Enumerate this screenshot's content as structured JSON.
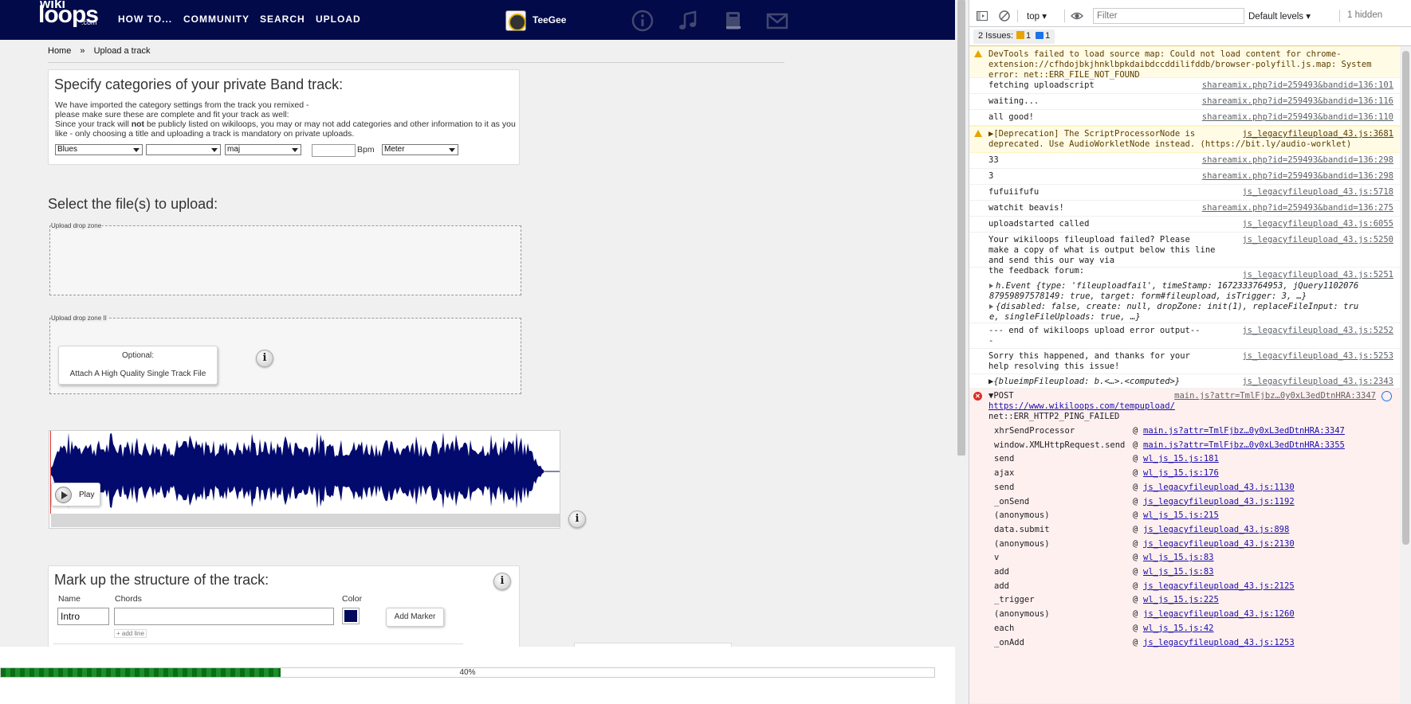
{
  "site": {
    "logo": {
      "line1": "wiki",
      "line2": "loops",
      "line3": ".com"
    },
    "nav": [
      "HOW TO...",
      "COMMUNITY",
      "SEARCH",
      "UPLOAD"
    ],
    "user": "TeeGee",
    "nav_icons": [
      "info-icon",
      "music-note-icon",
      "book-icon",
      "mail-icon"
    ],
    "breadcrumb": {
      "home": "Home",
      "sep": "»",
      "current": "Upload a track"
    },
    "categories": {
      "title": "Specify categories of your private Band track:",
      "text1": "We have imported the category settings from the track you remixed -",
      "text2": "please make sure these are complete and fit your track as well:",
      "text3_pre": "Since your track will ",
      "text3_bold": "not",
      "text3_post": " be publicly listed on wikiloops, you may or may not add categories and other information to it as you like - only choosing a title and uploading a track is mandatory on private uploads.",
      "genre": "Blues",
      "second": "",
      "key_mode": "maj",
      "bpm": "",
      "bpm_label": "Bpm",
      "meter": "Meter"
    },
    "select_heading": "Select the file(s) to upload:",
    "dropzone1_label": "Upload drop zone",
    "dropzone2_label": "Upload drop zone II",
    "attach": {
      "line1": "Optional:",
      "line2": "Attach A High Quality Single Track File"
    },
    "info_glyph": "i",
    "play_label": "Play",
    "markup": {
      "title": "Mark up the structure of the track:",
      "name_label": "Name",
      "chords_label": "Chords",
      "color_label": "Color",
      "name_value": "Intro",
      "chords_value": "",
      "add_marker": "Add Marker",
      "add_line": "+ add line",
      "marker_color": "#020a5e"
    },
    "progress": {
      "percent": 40,
      "label": "40%"
    },
    "colors": {
      "nav_bg": "#020a4a",
      "wave": "#020a6e",
      "progress": "#1c8f2a"
    }
  },
  "devtools": {
    "context": "top",
    "filter_placeholder": "Filter",
    "levels": "Default levels ▾",
    "hidden": "1 hidden",
    "issues": {
      "label": "2 Issues:",
      "warn": "1",
      "info": "1"
    },
    "rows": [
      {
        "type": "warn",
        "msg": "DevTools failed to load source map: Could not load content for chrome-extension://cfhdojbkjhnklbpkdaibdccddilifddb/browser-polyfill.js.map: System error: net::ERR_FILE_NOT_FOUND",
        "src": ""
      },
      {
        "type": "log",
        "msg": "fetching uploadscript",
        "src": "shareamix.php?id=259493&bandid=136:101"
      },
      {
        "type": "log",
        "msg": "waiting...",
        "src": "shareamix.php?id=259493&bandid=136:116"
      },
      {
        "type": "log",
        "msg": "all good!",
        "src": "shareamix.php?id=259493&bandid=136:110"
      },
      {
        "type": "warn",
        "msg": "▶[Deprecation] The ScriptProcessorNode is\ndeprecated. Use AudioWorkletNode instead. (https://bit.ly/audio-worklet)",
        "src": "js_legacyfileupload_43.js:3681"
      },
      {
        "type": "log",
        "msg": "33",
        "src": "shareamix.php?id=259493&bandid=136:298"
      },
      {
        "type": "log",
        "msg": "3",
        "src": "shareamix.php?id=259493&bandid=136:298"
      },
      {
        "type": "log",
        "msg": "fufuiifufu",
        "src": "js_legacyfileupload_43.js:5718"
      },
      {
        "type": "log",
        "msg": "watchit beavis!",
        "src": "shareamix.php?id=259493&bandid=136:275"
      },
      {
        "type": "log",
        "msg": "uploadstarted called",
        "src": "js_legacyfileupload_43.js:6055"
      },
      {
        "type": "log",
        "msg": "Your wikiloops fileupload failed? Please\nmake a copy of what is output below this line and send this our way via\nthe feedback forum:",
        "src": "js_legacyfileupload_43.js:5250"
      },
      {
        "type": "log",
        "msg": "",
        "src": "js_legacyfileupload_43.js:5251"
      },
      {
        "type": "log",
        "msg": "--- end of wikiloops upload error output--\n-",
        "src": "js_legacyfileupload_43.js:5252"
      },
      {
        "type": "log",
        "msg": "Sorry this happened, and thanks for your\nhelp resolving this issue!",
        "src": "js_legacyfileupload_43.js:5253"
      },
      {
        "type": "log",
        "msg": "▶{blueimpFileupload: b.<…>.<computed>}",
        "src": "js_legacyfileupload_43.js:2343"
      }
    ],
    "objects": [
      "h.Event {type: 'fileuploadfail', timeStamp: 1672333764953, jQuery1102076\n87959897578149: true, target: form#fileupload, isTrigger: 3, …}",
      "{disabled: false, create: null, dropZone: init(1), replaceFileInput: tru\ne, singleFileUploads: true, …}"
    ],
    "error": {
      "method": "▼POST ",
      "url": "https://www.wikiloops.com/tempupload/",
      "src": "main.js?attr=TmlFjbz…0y0xL3edDtnHRA:3347",
      "code": "net::ERR_HTTP2_PING_FAILED"
    },
    "stack": [
      {
        "fn": "xhrSendProcessor",
        "src": "main.js?attr=TmlFjbz…0y0xL3edDtnHRA:3347"
      },
      {
        "fn": "window.XMLHttpRequest.send",
        "src": "main.js?attr=TmlFjbz…0y0xL3edDtnHRA:3355"
      },
      {
        "fn": "send",
        "src": "wl_js_15.js:181"
      },
      {
        "fn": "ajax",
        "src": "wl_js_15.js:176"
      },
      {
        "fn": "send",
        "src": "js_legacyfileupload_43.js:1130"
      },
      {
        "fn": "_onSend",
        "src": "js_legacyfileupload_43.js:1192"
      },
      {
        "fn": "(anonymous)",
        "src": "wl_js_15.js:215"
      },
      {
        "fn": "data.submit",
        "src": "js_legacyfileupload_43.js:898"
      },
      {
        "fn": "(anonymous)",
        "src": "js_legacyfileupload_43.js:2130"
      },
      {
        "fn": "v",
        "src": "wl_js_15.js:83"
      },
      {
        "fn": "add",
        "src": "wl_js_15.js:83"
      },
      {
        "fn": "add",
        "src": "js_legacyfileupload_43.js:2125"
      },
      {
        "fn": "_trigger",
        "src": "wl_js_15.js:225"
      },
      {
        "fn": "(anonymous)",
        "src": "js_legacyfileupload_43.js:1260"
      },
      {
        "fn": "each",
        "src": "wl_js_15.js:42"
      },
      {
        "fn": "_onAdd",
        "src": "js_legacyfileupload_43.js:1253"
      }
    ]
  }
}
